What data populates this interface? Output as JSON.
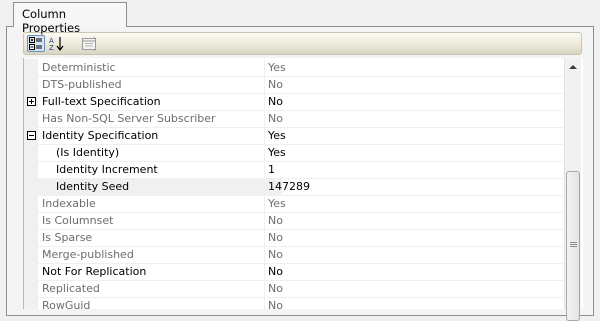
{
  "tab": {
    "label": "Column Properties"
  },
  "toolbar": {
    "categorized_icon": "categorized-icon",
    "alphabetical_icon": "alphabetical-sort-icon",
    "property_pages_icon": "property-pages-icon"
  },
  "rows": [
    {
      "name": "Deterministic",
      "value": "Yes",
      "readonly": true
    },
    {
      "name": "DTS-published",
      "value": "No",
      "readonly": true
    },
    {
      "name": "Full-text Specification",
      "value": "No",
      "readonly": false,
      "expander": "plus"
    },
    {
      "name": "Has Non-SQL Server Subscriber",
      "value": "No",
      "readonly": true
    },
    {
      "name": "Identity Specification",
      "value": "Yes",
      "readonly": false,
      "expander": "minus"
    },
    {
      "name": "(Is Identity)",
      "value": "Yes",
      "readonly": false,
      "indent": true
    },
    {
      "name": "Identity Increment",
      "value": "1",
      "readonly": false,
      "indent": true
    },
    {
      "name": "Identity Seed",
      "value": "147289",
      "readonly": false,
      "indent": true,
      "selected": true
    },
    {
      "name": "Indexable",
      "value": "Yes",
      "readonly": true
    },
    {
      "name": "Is Columnset",
      "value": "No",
      "readonly": true
    },
    {
      "name": "Is Sparse",
      "value": "No",
      "readonly": true
    },
    {
      "name": "Merge-published",
      "value": "No",
      "readonly": true
    },
    {
      "name": "Not For Replication",
      "value": "No",
      "readonly": false
    },
    {
      "name": "Replicated",
      "value": "No",
      "readonly": true
    },
    {
      "name": "RowGuid",
      "value": "No",
      "readonly": true
    }
  ]
}
